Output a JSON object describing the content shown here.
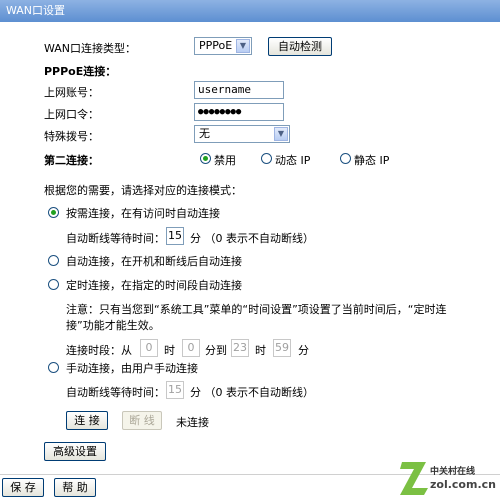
{
  "window": {
    "title": "WAN口设置"
  },
  "wan": {
    "type_label": "WAN口连接类型：",
    "type_value": "PPPoE",
    "auto_detect_label": "自动检测"
  },
  "pppoe": {
    "section_label": "PPPoE连接：",
    "account_label": "上网账号：",
    "account_value": "username",
    "password_label": "上网口令：",
    "password_value": "●●●●●●●●",
    "dial_label": "特殊拨号：",
    "dial_value": "无"
  },
  "second_conn": {
    "label": "第二连接：",
    "options": [
      "禁用",
      "动态 IP",
      "静态 IP"
    ],
    "selected": "禁用"
  },
  "mode": {
    "prompt": "根据您的需要，请选择对应的连接模式：",
    "on_demand_label": "按需连接，在有访问时自动连接",
    "on_demand_idle_label": "自动断线等待时间：",
    "on_demand_idle_value": "15",
    "on_demand_idle_unit": "分 （0 表示不自动断线）",
    "auto_label": "自动连接，在开机和断线后自动连接",
    "timed_label": "定时连接，在指定的时间段自动连接",
    "note_line1": "注意：只有当您到“系统工具”菜单的“时间设置”项设置了当前时间后，“定时连",
    "note_line2": "接”功能才能生效。",
    "period_prefix": "连接时段：从",
    "period_from_hour": "0",
    "period_hour1": "时",
    "period_from_min": "0",
    "period_min_to": "分到",
    "period_to_hour": "23",
    "period_hour2": "时",
    "period_to_min": "59",
    "period_min2": "分",
    "manual_label": "手动连接，由用户手动连接",
    "manual_idle_label": "自动断线等待时间：",
    "manual_idle_value": "15",
    "manual_idle_unit": "分 （0 表示不自动断线）",
    "selected": "按需连接"
  },
  "actions": {
    "connect_label": "连 接",
    "disconnect_label": "断 线",
    "status_text": "未连接",
    "advanced_label": "高级设置",
    "save_label": "保 存",
    "help_label": "帮 助"
  },
  "watermark": {
    "brand_cn": "中关村在线",
    "brand_en": "zol.com.cn"
  },
  "colors": {
    "titlebar": "#6c9bd8",
    "radio_selected": "#21a121"
  }
}
